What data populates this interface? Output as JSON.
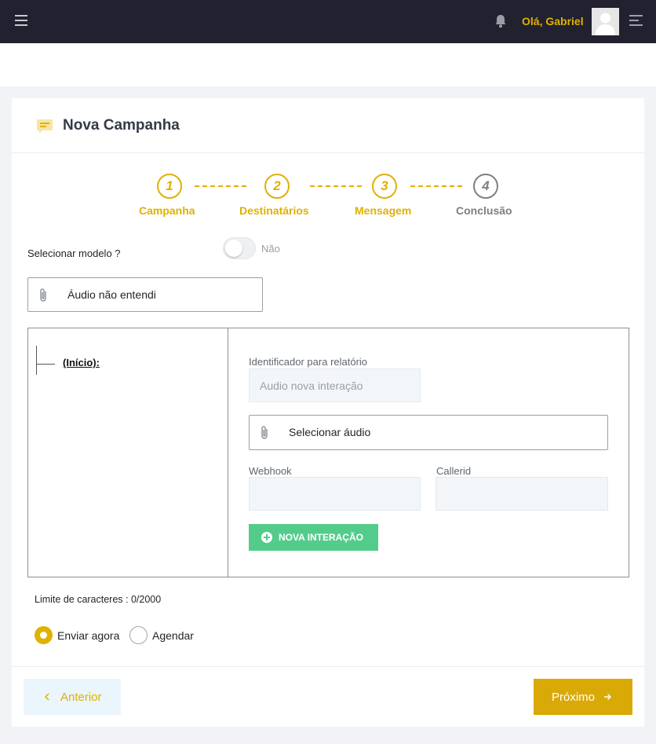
{
  "topbar": {
    "greeting": "Olá, Gabriel",
    "icons": [
      "hamburger-icon",
      "bell-icon",
      "avatar",
      "menu-lines-icon"
    ]
  },
  "page": {
    "title": "Nova Campanha",
    "title_icon": "message-icon"
  },
  "steps": [
    {
      "number": "1",
      "label": "Campanha",
      "state": "active"
    },
    {
      "number": "2",
      "label": "Destinatários",
      "state": "active"
    },
    {
      "number": "3",
      "label": "Mensagem",
      "state": "active"
    },
    {
      "number": "4",
      "label": "Conclusão",
      "state": "inactive"
    }
  ],
  "form": {
    "select_model_label": "Selecionar modelo ?",
    "toggle_text": "Não",
    "file_name": "Áudio não entendi",
    "tree": {
      "root_node": "(Início):"
    },
    "interaction": {
      "report_id_label": "Identificador para relatório",
      "report_id_placeholder": "Audio nova interação",
      "select_audio": "Selecionar áudio",
      "webhook_label": "Webhook",
      "callerid_label": "Callerid",
      "new_interaction_button": "NOVA INTERAÇÃO"
    },
    "char_limit": "Limite de caracteres : 0/2000",
    "send_options": [
      {
        "label": "Enviar agora",
        "selected": true
      },
      {
        "label": "Agendar",
        "selected": false
      }
    ]
  },
  "footer": {
    "prev_label": "Anterior",
    "next_label": "Próximo"
  },
  "colors": {
    "accent": "#e0b100",
    "green": "#53cc8b",
    "topbar": "#21212f"
  }
}
